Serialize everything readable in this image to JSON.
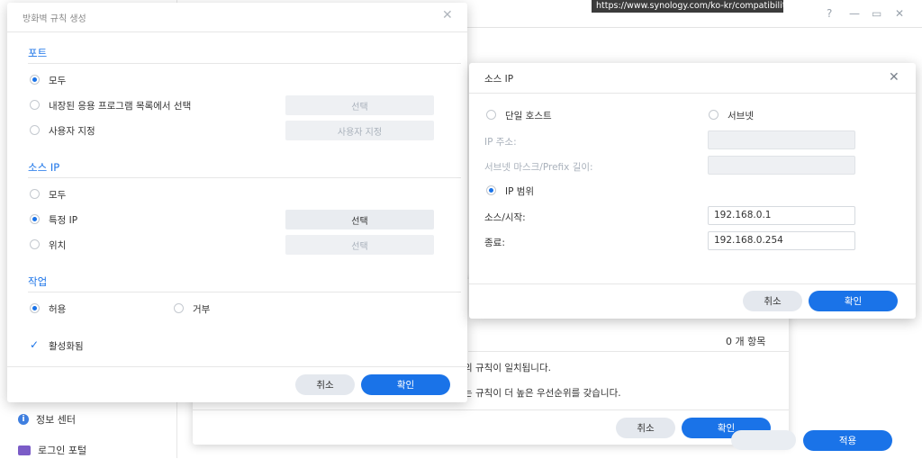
{
  "tooltip": {
    "url": "https://www.synology.com/ko-kr/compatibility..."
  },
  "window_controls": {
    "help": "?",
    "minimize": "—",
    "maximize": "▭",
    "close": "✕"
  },
  "sidebar": {
    "items": [
      {
        "label": "정보 센터"
      },
      {
        "label": "로그인 포털"
      }
    ]
  },
  "rules_dialog": {
    "count": "0 개 항목",
    "text1": "의 규칙이 일치됩니다.",
    "text2": "는 규칙이 더 높은 우선순위를 갖습니다.",
    "cancel": "취소",
    "ok": "확인",
    "apply": "적용"
  },
  "firewall_dialog": {
    "title": "방화벽 규칙 생성",
    "close": "✕",
    "port_section": "포트",
    "port_all": "모두",
    "port_builtin": "내장된 응용 프로그램 목록에서 선택",
    "port_builtin_btn": "선택",
    "port_custom": "사용자 지정",
    "port_custom_btn": "사용자 지정",
    "srcip_section": "소스 IP",
    "srcip_all": "모두",
    "srcip_specific": "특정 IP",
    "srcip_specific_btn": "선택",
    "srcip_location": "위치",
    "srcip_location_btn": "선택",
    "action_section": "작업",
    "action_allow": "허용",
    "action_deny": "거부",
    "enabled": "활성화됨",
    "cancel": "취소",
    "ok": "확인"
  },
  "ip_dialog": {
    "title": "소스 IP",
    "close": "✕",
    "single_host": "단일 호스트",
    "subnet": "서브넷",
    "ip_address_label": "IP 주소:",
    "mask_label": "서브넷 마스크/Prefix 길이:",
    "ip_range": "IP 범위",
    "start_label": "소스/시작:",
    "start_value": "192.168.0.1",
    "end_label": "종료:",
    "end_value": "192.168.0.254",
    "cancel": "취소",
    "ok": "확인"
  },
  "colors": {
    "accent": "#1a73e8",
    "section": "#1a73e8"
  }
}
